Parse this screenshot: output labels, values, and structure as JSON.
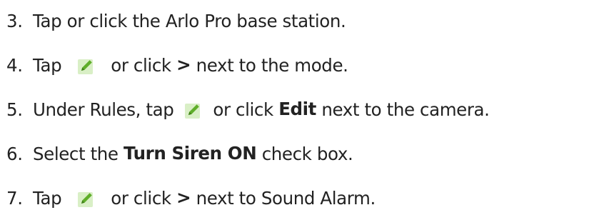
{
  "steps": [
    {
      "number": "3.",
      "parts": [
        "Tap or click the Arlo Pro base station."
      ]
    },
    {
      "number": "4.",
      "parts": [
        "Tap",
        "or click",
        ">",
        "next to the mode."
      ]
    },
    {
      "number": "5.",
      "parts": [
        "Under Rules, tap",
        "or click",
        "Edit",
        "next to the camera."
      ]
    },
    {
      "number": "6.",
      "parts": [
        "Select the",
        "Turn Siren ON",
        "check box."
      ]
    },
    {
      "number": "7.",
      "parts": [
        "Tap",
        "or click",
        ">",
        "next to Sound Alarm."
      ]
    }
  ],
  "icons": {
    "edit": "edit-pencil-icon"
  },
  "colors": {
    "text": "#222222",
    "icon_bg": "#d9efc6",
    "icon_pencil": "#5fae2a"
  }
}
